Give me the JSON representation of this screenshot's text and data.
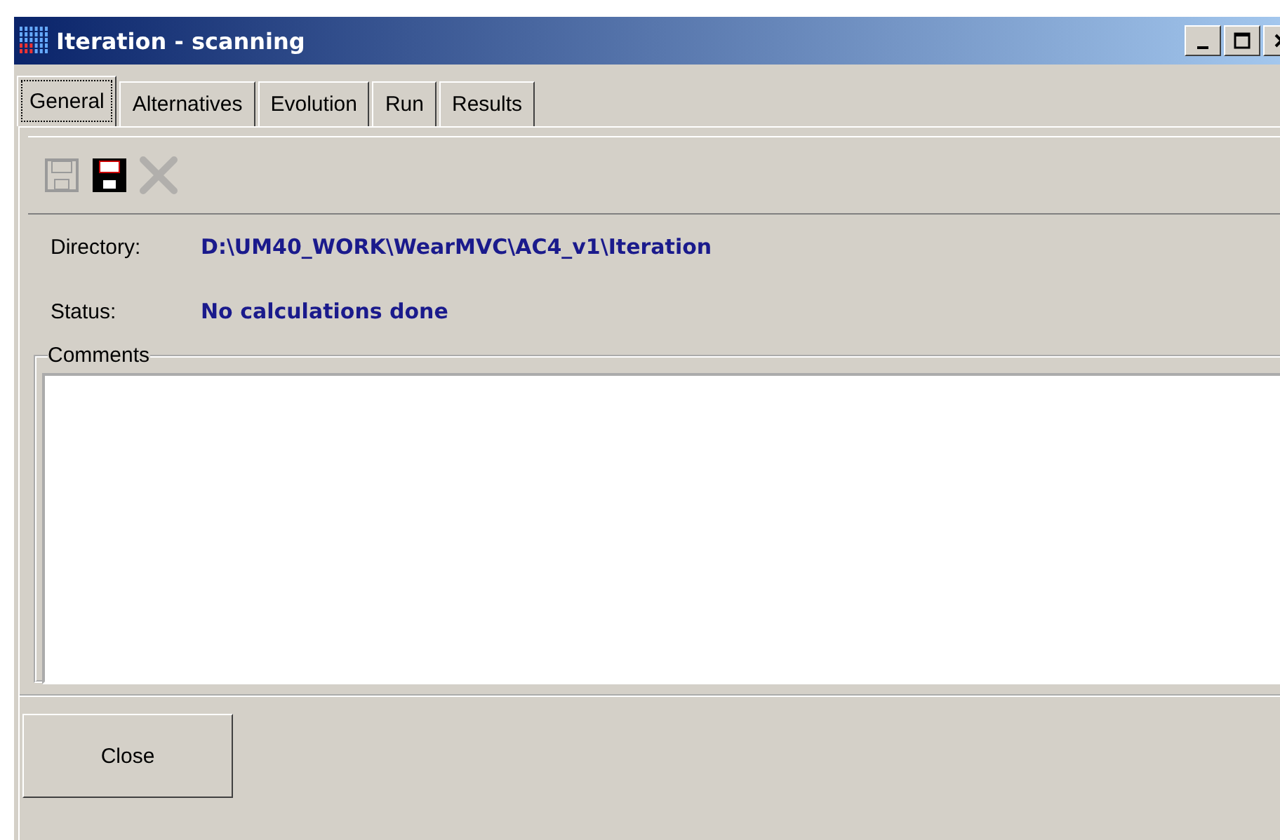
{
  "window": {
    "title": "Iteration - scanning"
  },
  "tabs": [
    {
      "label": "General",
      "selected": true
    },
    {
      "label": "Alternatives",
      "selected": false
    },
    {
      "label": "Evolution",
      "selected": false
    },
    {
      "label": "Run",
      "selected": false
    },
    {
      "label": "Results",
      "selected": false
    }
  ],
  "toolbar": [
    {
      "kind": "save",
      "disabled": true
    },
    {
      "kind": "save",
      "disabled": false
    },
    {
      "kind": "delete",
      "disabled": true
    }
  ],
  "fields": [
    {
      "label": "Directory:",
      "value": "D:\\UM40_WORK\\WearMVC\\AC4_v1\\Iteration"
    },
    {
      "label": "Status:",
      "value": "No calculations done"
    }
  ],
  "comments": {
    "legend": "Comments"
  },
  "buttons": [
    "Close"
  ]
}
